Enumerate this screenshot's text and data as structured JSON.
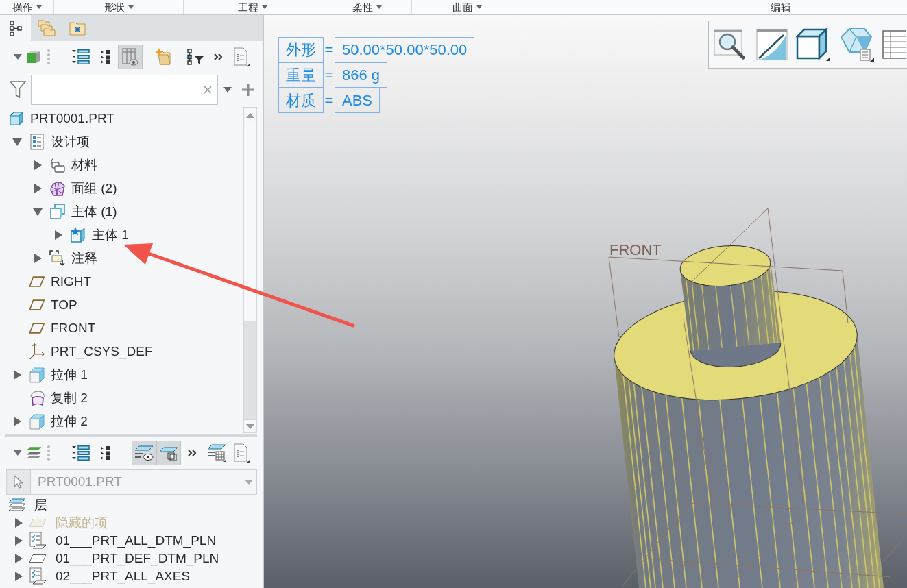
{
  "ribbon_groups": [
    {
      "label": "操作",
      "dropdown": true
    },
    {
      "label": "形状",
      "dropdown": true
    },
    {
      "label": "工程",
      "dropdown": true
    },
    {
      "label": "柔性",
      "dropdown": true
    },
    {
      "label": "曲面",
      "dropdown": true
    },
    {
      "label": "编辑",
      "dropdown": false
    }
  ],
  "navigator": {
    "tabs": [
      {
        "kind": "model-tree",
        "selected": true
      },
      {
        "kind": "folders",
        "selected": false
      },
      {
        "kind": "favorites",
        "selected": false
      }
    ],
    "tree_toolbar": [
      {
        "kind": "show-menu",
        "pressed": false
      },
      {
        "kind": "grip"
      },
      {
        "kind": "expand-all",
        "pressed": false
      },
      {
        "kind": "collapse-level",
        "pressed": false
      },
      {
        "kind": "columns",
        "pressed": true
      },
      {
        "kind": "separator"
      },
      {
        "kind": "new-folder",
        "pressed": false
      },
      {
        "kind": "separator"
      },
      {
        "kind": "tree-filter",
        "pressed": false
      },
      {
        "kind": "more",
        "pressed": false
      },
      {
        "kind": "settings",
        "pressed": false
      }
    ],
    "model_tree": {
      "root": {
        "label": "PRT0001.PRT",
        "kind": "part"
      },
      "items": [
        {
          "label": "设计项",
          "kind": "design-items",
          "expander": true,
          "expanded": true,
          "children": [
            {
              "label": "材料",
              "kind": "material",
              "expander": true,
              "expanded": false
            },
            {
              "label": "面组 (2)",
              "kind": "quilt",
              "expander": true,
              "expanded": false
            },
            {
              "label": "主体 (1)",
              "kind": "bodies",
              "expander": true,
              "expanded": true,
              "children": [
                {
                  "label": "主体 1",
                  "kind": "body",
                  "expander": true,
                  "expanded": false
                }
              ]
            },
            {
              "label": "注释",
              "kind": "annotation",
              "expander": true,
              "expanded": false
            }
          ]
        },
        {
          "label": "RIGHT",
          "kind": "datum-plane",
          "expander": false
        },
        {
          "label": "TOP",
          "kind": "datum-plane",
          "expander": false
        },
        {
          "label": "FRONT",
          "kind": "datum-plane",
          "expander": false
        },
        {
          "label": "PRT_CSYS_DEF",
          "kind": "csys",
          "expander": false
        },
        {
          "label": "拉伸 1",
          "kind": "extrude",
          "expander": true,
          "expanded": false
        },
        {
          "label": "复制 2",
          "kind": "copy",
          "expander": false
        },
        {
          "label": "拉伸 2",
          "kind": "extrude",
          "expander": true,
          "expanded": false
        }
      ]
    },
    "layer_toolbar": [
      {
        "kind": "show-layers",
        "pressed": false
      },
      {
        "kind": "grip"
      },
      {
        "kind": "expand-all",
        "pressed": false
      },
      {
        "kind": "collapse-level",
        "pressed": false
      },
      {
        "kind": "separator"
      },
      {
        "kind": "layer-visibility",
        "pressed": true
      },
      {
        "kind": "layer-isolate",
        "pressed": true
      },
      {
        "kind": "more",
        "pressed": false
      },
      {
        "kind": "layer-table",
        "pressed": false
      },
      {
        "kind": "settings",
        "pressed": false
      }
    ],
    "layer_tree": {
      "model_select": {
        "value": "PRT0001.PRT",
        "disabled": true
      },
      "header": "层",
      "items": [
        {
          "label": "隐藏的项",
          "kind": "hidden",
          "expanded": false
        },
        {
          "label": "01___PRT_ALL_DTM_PLN",
          "kind": "rule-layer",
          "expanded": false
        },
        {
          "label": "01___PRT_DEF_DTM_PLN",
          "kind": "layer",
          "expanded": false
        },
        {
          "label": "02___PRT_ALL_AXES",
          "kind": "rule-layer",
          "expanded": false
        }
      ]
    }
  },
  "graphics": {
    "parameters": [
      {
        "name": "外形",
        "operator": "=",
        "value": "50.00*50.00*50.00"
      },
      {
        "name": "重量",
        "operator": "=",
        "value": "866 g"
      },
      {
        "name": "材质",
        "operator": "=",
        "value": "ABS"
      }
    ],
    "datum_label": "FRONT"
  }
}
